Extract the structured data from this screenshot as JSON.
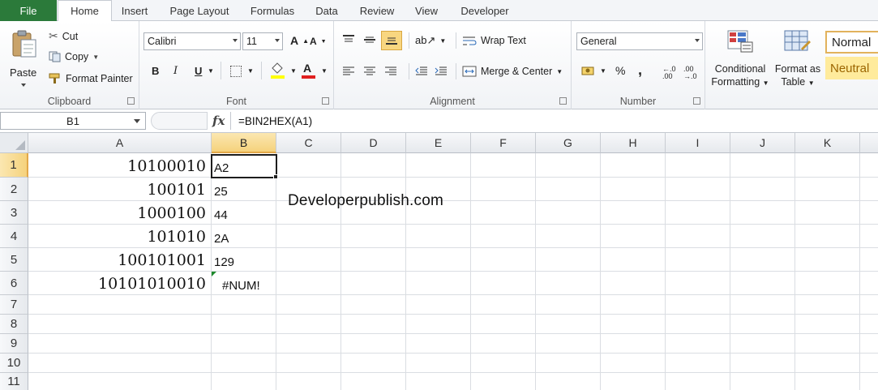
{
  "tabs": {
    "file": "File",
    "items": [
      "Home",
      "Insert",
      "Page Layout",
      "Formulas",
      "Data",
      "Review",
      "View",
      "Developer"
    ],
    "active": "Home"
  },
  "clipboard": {
    "paste": "Paste",
    "cut": "Cut",
    "copy": "Copy",
    "format_painter": "Format Painter",
    "label": "Clipboard"
  },
  "font": {
    "name": "Calibri",
    "size": "11",
    "bold": "B",
    "italic": "I",
    "underline": "U",
    "font_color_glyph": "A",
    "label": "Font",
    "font_color": "#e02020",
    "fill_color": "#ffff00"
  },
  "alignment": {
    "wrap_text": "Wrap Text",
    "merge_center": "Merge & Center",
    "label": "Alignment"
  },
  "number": {
    "format": "General",
    "percent": "%",
    "comma": ",",
    "label": "Number"
  },
  "styles": {
    "conditional_line1": "Conditional",
    "conditional_line2": "Formatting",
    "format_as_line1": "Format as",
    "format_as_line2": "Table",
    "normal": "Normal",
    "neutral": "Neutral"
  },
  "formula_bar": {
    "name_box": "B1",
    "fx": "fx",
    "formula": "=BIN2HEX(A1)"
  },
  "sheet": {
    "columns": [
      "A",
      "B",
      "C",
      "D",
      "E",
      "F",
      "G",
      "H",
      "I",
      "J",
      "K"
    ],
    "rows": [
      "1",
      "2",
      "3",
      "4",
      "5",
      "6",
      "7",
      "8",
      "9",
      "10",
      "11"
    ],
    "selected_cell": "B1",
    "colA": [
      "10100010",
      "100101",
      "1000100",
      "101010",
      "100101001",
      "10101010010"
    ],
    "colB": [
      "A2",
      "25",
      "44",
      "2A",
      "129",
      "#NUM!"
    ],
    "overlay_text": "Developerpublish.com"
  }
}
